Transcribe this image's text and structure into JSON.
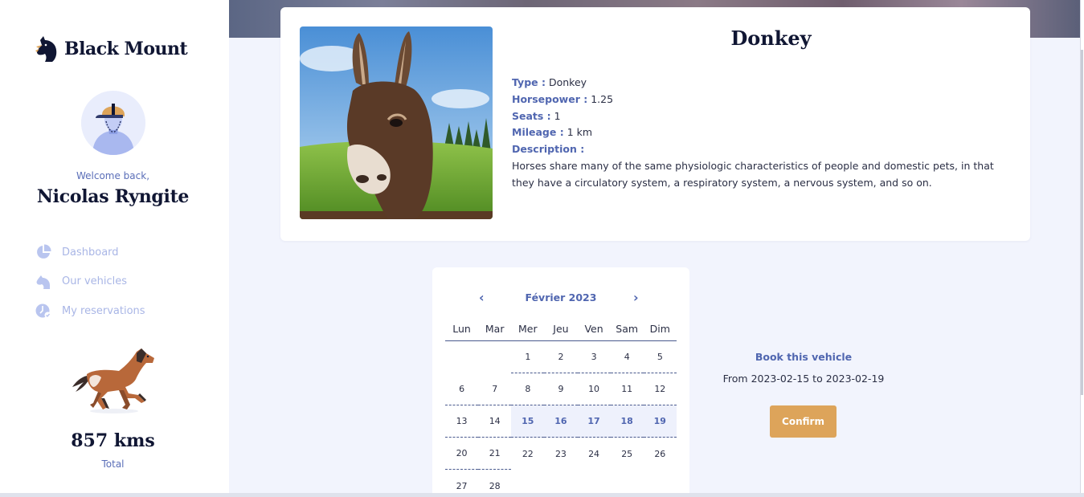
{
  "app": {
    "brand_name": "Black Mount",
    "logo_icon": "horse-head-logo"
  },
  "user": {
    "welcome": "Welcome back,",
    "name": "Nicolas Ryngite"
  },
  "nav": {
    "items": [
      {
        "label": "Dashboard",
        "icon": "pie-chart-icon"
      },
      {
        "label": "Our vehicles",
        "icon": "horse-icon"
      },
      {
        "label": "My reservations",
        "icon": "clock-check-icon"
      }
    ]
  },
  "stats": {
    "distance": "857 kms",
    "label": "Total"
  },
  "vehicle": {
    "name": "Donkey",
    "fields": [
      {
        "key": "Type :",
        "value": "Donkey"
      },
      {
        "key": "Horsepower :",
        "value": "1.25"
      },
      {
        "key": "Seats :",
        "value": "1"
      },
      {
        "key": "Mileage :",
        "value": "1 km"
      },
      {
        "key": "Description :",
        "value": ""
      }
    ],
    "description": "Horses share many of the same physiologic characteristics of people and domestic pets, in that they have a circulatory system, a respiratory system, a nervous system, and so on."
  },
  "calendar": {
    "month_label": "Février 2023",
    "prev": "‹",
    "next": "›",
    "weekdays": [
      "Lun",
      "Mar",
      "Mer",
      "Jeu",
      "Ven",
      "Sam",
      "Dim"
    ],
    "weeks": [
      [
        "",
        "",
        "1",
        "2",
        "3",
        "4",
        "5"
      ],
      [
        "6",
        "7",
        "8",
        "9",
        "10",
        "11",
        "12"
      ],
      [
        "13",
        "14",
        "15",
        "16",
        "17",
        "18",
        "19"
      ],
      [
        "20",
        "21",
        "22",
        "23",
        "24",
        "25",
        "26"
      ],
      [
        "27",
        "28",
        "",
        "",
        "",
        "",
        ""
      ]
    ],
    "selected_days": [
      "15",
      "16",
      "17",
      "18",
      "19"
    ]
  },
  "booking": {
    "title": "Book this vehicle",
    "range": "From 2023-02-15 to 2023-02-19",
    "confirm_label": "Confirm"
  },
  "colors": {
    "accent": "#5066b0",
    "confirm": "#dda45a",
    "dark": "#101633",
    "muted": "#a9b6e6",
    "background": "#f2f4fd"
  }
}
